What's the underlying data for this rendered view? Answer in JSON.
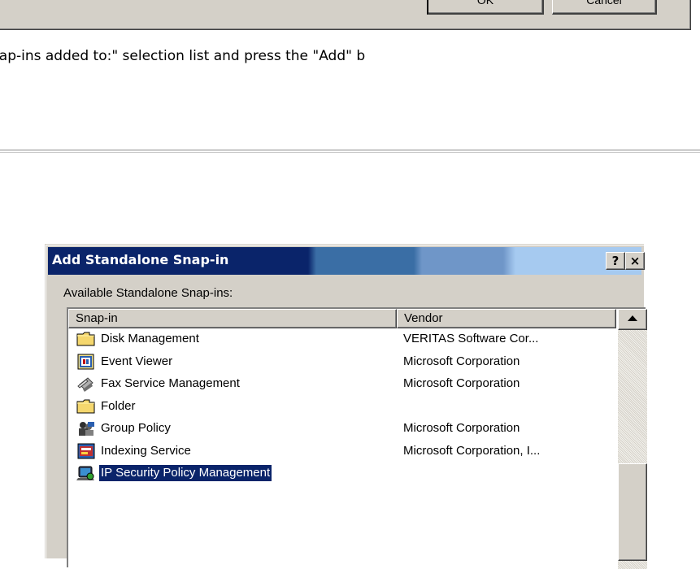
{
  "top_dialog": {
    "ok_label": "OK",
    "cancel_label": "Cancel"
  },
  "instruction_text": "nap-ins added to:\" selection list and press the \"Add\" b",
  "dialog": {
    "title": "Add Standalone Snap-in",
    "help_button": "?",
    "close_button": "×",
    "available_label": "Available Standalone Snap-ins:",
    "columns": [
      "Snap-in",
      "Vendor"
    ],
    "rows": [
      {
        "name": "Disk Management",
        "vendor": "VERITAS Software Cor...",
        "icon": "folder-icon"
      },
      {
        "name": "Event Viewer",
        "vendor": "Microsoft Corporation",
        "icon": "event-viewer-icon"
      },
      {
        "name": "Fax Service Management",
        "vendor": "Microsoft Corporation",
        "icon": "fax-icon"
      },
      {
        "name": "Folder",
        "vendor": "",
        "icon": "folder-icon"
      },
      {
        "name": "Group Policy",
        "vendor": "Microsoft Corporation",
        "icon": "group-policy-icon"
      },
      {
        "name": "Indexing Service",
        "vendor": "Microsoft Corporation, I...",
        "icon": "indexing-service-icon"
      },
      {
        "name": "IP Security Policy Management",
        "vendor": "",
        "icon": "ip-security-icon",
        "selected": true
      }
    ]
  },
  "colors": {
    "selection": "#0a246a",
    "titlebar_start": "#0a246a",
    "titlebar_end": "#a6caf0",
    "face": "#d4d0c8"
  }
}
